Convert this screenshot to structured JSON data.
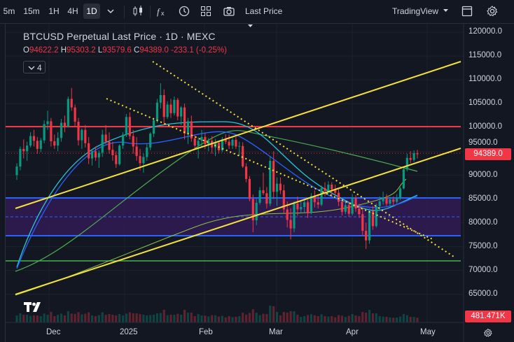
{
  "toolbar": {
    "intervals": [
      "5m",
      "15m",
      "1H",
      "4H",
      "1D"
    ],
    "active_interval": "1D",
    "price_type": "Last Price",
    "layout_name": "TradingView",
    "icons": [
      "chevron-down-icon",
      "candles-icon",
      "indicators-icon",
      "alert-icon",
      "templates-icon",
      "camera-icon",
      "fullscreen-icon",
      "settings-gear-icon"
    ]
  },
  "legend": {
    "title": "BTCUSD Perpetual Last Price · 1D · MEXC",
    "open_key": "O",
    "open": "94622.2",
    "high_key": "H",
    "high": "95303.2",
    "low_key": "L",
    "low": "93579.6",
    "close_key": "C",
    "close": "94389.0",
    "change": "-233.1 (-0.25%)",
    "indicators_count": "4"
  },
  "price_axis": {
    "ticks": [
      "120000.0",
      "115000.0",
      "110000.0",
      "105000.0",
      "100000.0",
      "95000.0",
      "90000.0",
      "85000.0",
      "80000.0",
      "75000.0",
      "70000.0",
      "65000.0"
    ],
    "last_price_label": "94389.0",
    "volume_label": "481.471K"
  },
  "time_axis": {
    "ticks": [
      "Dec",
      "2025",
      "Feb",
      "Mar",
      "Apr",
      "May"
    ]
  },
  "colors": {
    "background": "#131722",
    "up": "#089981",
    "down": "#f23645",
    "yellow_line": "#f5e23b",
    "resistance": "#f23645",
    "zone_fill": "#311b55",
    "zone_border": "#2962ff"
  },
  "chart_data": {
    "type": "candlestick",
    "title": "BTCUSD Perpetual Last Price · 1D · MEXC",
    "ylim": [
      65000,
      120000
    ],
    "x": [
      "Dec",
      "2025",
      "Feb",
      "Mar",
      "Apr",
      "May"
    ],
    "horizontal_levels": [
      100000,
      85000,
      77500,
      72000
    ],
    "dashed_level": 81000,
    "last_price": 94389.0,
    "series": [
      {
        "name": "",
        "values": [
          [
            90000,
            92500,
            89000,
            91800
          ],
          [
            91800,
            96000,
            91000,
            95500
          ],
          [
            95500,
            97500,
            93500,
            95000
          ],
          [
            95000,
            97000,
            93000,
            96200
          ],
          [
            96200,
            99000,
            95800,
            98200
          ],
          [
            98200,
            99500,
            96000,
            97200
          ],
          [
            97200,
            98000,
            94500,
            95500
          ],
          [
            95500,
            97800,
            94800,
            97300
          ],
          [
            97300,
            101500,
            96700,
            100700
          ],
          [
            100700,
            103500,
            99500,
            101300
          ],
          [
            101300,
            102000,
            96000,
            97100
          ],
          [
            97100,
            98500,
            95500,
            96200
          ],
          [
            96200,
            99000,
            95000,
            97800
          ],
          [
            97800,
            101800,
            97000,
            101000
          ],
          [
            101000,
            102500,
            99000,
            100200
          ],
          [
            100200,
            106500,
            100000,
            106000
          ],
          [
            106000,
            108300,
            103500,
            104200
          ],
          [
            104200,
            104800,
            100200,
            101200
          ],
          [
            101200,
            102000,
            96200,
            97300
          ],
          [
            97300,
            99800,
            95500,
            99500
          ],
          [
            99500,
            100500,
            95800,
            96700
          ],
          [
            96700,
            98000,
            92300,
            93500
          ],
          [
            93500,
            95500,
            92000,
            95000
          ],
          [
            95000,
            96000,
            93000,
            93700
          ],
          [
            93700,
            95200,
            91500,
            94700
          ],
          [
            94700,
            99500,
            93800,
            98500
          ],
          [
            98500,
            100500,
            96500,
            97000
          ],
          [
            97000,
            99000,
            94500,
            95300
          ],
          [
            95300,
            97000,
            93000,
            94200
          ],
          [
            94200,
            95000,
            91500,
            92300
          ],
          [
            92300,
            96500,
            92000,
            96200
          ],
          [
            96200,
            99000,
            95500,
            98500
          ],
          [
            98500,
            102800,
            98000,
            102200
          ],
          [
            102200,
            103200,
            97500,
            98200
          ],
          [
            98200,
            99500,
            94500,
            96000
          ],
          [
            96000,
            98000,
            93000,
            94000
          ],
          [
            94000,
            95500,
            91000,
            92500
          ],
          [
            92500,
            94500,
            90500,
            93800
          ],
          [
            93800,
            96500,
            93000,
            95800
          ],
          [
            95800,
            99000,
            95200,
            98700
          ],
          [
            98700,
            102000,
            98000,
            101500
          ],
          [
            101500,
            106000,
            101000,
            105200
          ],
          [
            105200,
            109300,
            104000,
            106800
          ],
          [
            106800,
            108000,
            100500,
            102200
          ],
          [
            102200,
            105500,
            101800,
            104800
          ],
          [
            104800,
            106000,
            102000,
            103000
          ],
          [
            103000,
            106500,
            102500,
            105800
          ],
          [
            105800,
            106200,
            101500,
            102300
          ],
          [
            102300,
            104500,
            100500,
            104200
          ],
          [
            104200,
            105000,
            97500,
            98700
          ],
          [
            98700,
            102000,
            96500,
            101300
          ],
          [
            101300,
            102500,
            97000,
            97700
          ],
          [
            97700,
            98500,
            95500,
            96200
          ],
          [
            96200,
            98000,
            93500,
            97200
          ],
          [
            97200,
            99500,
            96000,
            98000
          ],
          [
            98000,
            98800,
            95500,
            96500
          ],
          [
            96500,
            97800,
            95000,
            97200
          ],
          [
            97200,
            98200,
            94500,
            95800
          ],
          [
            95800,
            97600,
            94000,
            96800
          ],
          [
            96800,
            97200,
            94500,
            95200
          ],
          [
            95200,
            98000,
            94800,
            97500
          ],
          [
            97500,
            98600,
            96500,
            97000
          ],
          [
            97000,
            98500,
            95500,
            96200
          ],
          [
            96200,
            97800,
            95500,
            97400
          ],
          [
            97400,
            98000,
            95500,
            96000
          ],
          [
            96000,
            97000,
            94000,
            96100
          ],
          [
            96100,
            96900,
            91500,
            91800
          ],
          [
            91800,
            92500,
            88500,
            89200
          ],
          [
            89200,
            89800,
            84500,
            85000
          ],
          [
            85000,
            85900,
            78000,
            80500
          ],
          [
            80500,
            85000,
            79500,
            84200
          ],
          [
            84200,
            87500,
            83800,
            86800
          ],
          [
            86800,
            90500,
            85800,
            86200
          ],
          [
            86200,
            87500,
            83000,
            84000
          ],
          [
            84000,
            94000,
            83500,
            93000
          ],
          [
            93000,
            95000,
            85000,
            86500
          ],
          [
            86500,
            89500,
            83500,
            88200
          ],
          [
            88200,
            89500,
            86000,
            86800
          ],
          [
            86800,
            88000,
            82000,
            82800
          ],
          [
            82800,
            84500,
            79000,
            80600
          ],
          [
            80600,
            83000,
            76500,
            78800
          ],
          [
            78800,
            84500,
            78000,
            84000
          ],
          [
            84000,
            85500,
            81500,
            82800
          ],
          [
            82800,
            84500,
            82000,
            83300
          ],
          [
            83300,
            85000,
            82000,
            84300
          ],
          [
            84300,
            84800,
            81000,
            82000
          ],
          [
            82000,
            86200,
            81800,
            85600
          ],
          [
            85600,
            86800,
            83200,
            84300
          ],
          [
            84300,
            86000,
            83000,
            83800
          ],
          [
            83800,
            87800,
            83500,
            87300
          ],
          [
            87300,
            88500,
            85500,
            86700
          ],
          [
            86700,
            88700,
            86000,
            88000
          ],
          [
            88000,
            88500,
            85500,
            87000
          ],
          [
            87000,
            88000,
            85800,
            86300
          ],
          [
            86300,
            87200,
            83500,
            84400
          ],
          [
            84400,
            84800,
            81500,
            82300
          ],
          [
            82300,
            84200,
            81800,
            83700
          ],
          [
            83700,
            84400,
            81200,
            81900
          ],
          [
            81900,
            86000,
            81500,
            85200
          ],
          [
            85200,
            85800,
            82300,
            83000
          ],
          [
            83000,
            84000,
            81000,
            81800
          ],
          [
            81800,
            83200,
            77200,
            78300
          ],
          [
            78300,
            80000,
            74500,
            76300
          ],
          [
            76300,
            83000,
            75600,
            82500
          ],
          [
            82500,
            83500,
            78500,
            79300
          ],
          [
            79300,
            84000,
            79000,
            83500
          ],
          [
            83500,
            85500,
            82500,
            84500
          ],
          [
            84500,
            86500,
            83800,
            85300
          ],
          [
            85300,
            86000,
            83500,
            84000
          ],
          [
            84000,
            85500,
            83500,
            84900
          ],
          [
            84900,
            85500,
            83700,
            84400
          ],
          [
            84400,
            86000,
            84000,
            85200
          ],
          [
            85200,
            87500,
            84800,
            87200
          ],
          [
            87200,
            91500,
            87000,
            91200
          ],
          [
            91200,
            94500,
            90800,
            93600
          ],
          [
            93600,
            95000,
            92500,
            93200
          ],
          [
            93200,
            95200,
            92800,
            94600
          ],
          [
            94600,
            95300,
            93500,
            94389
          ]
        ]
      }
    ]
  }
}
